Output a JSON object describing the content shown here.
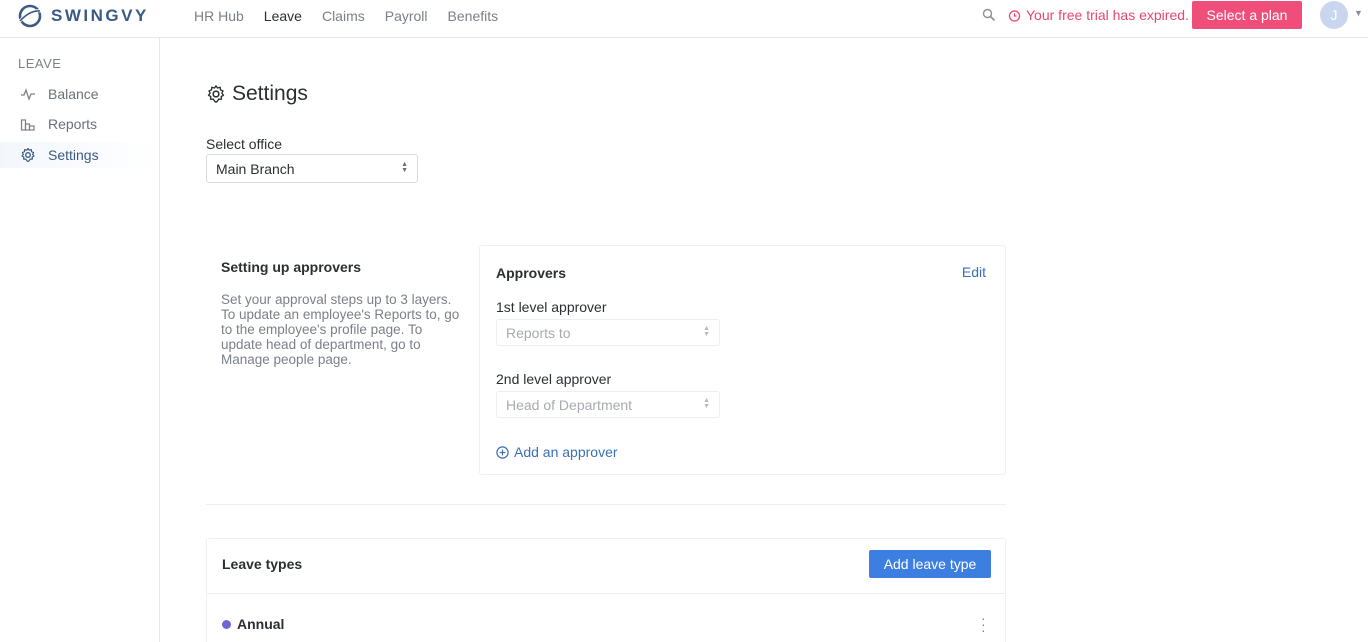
{
  "brand": {
    "name": "SWINGVY"
  },
  "nav": {
    "items": [
      "HR Hub",
      "Leave",
      "Claims",
      "Payroll",
      "Benefits"
    ],
    "active_index": 1
  },
  "trial": {
    "text": "Your free trial has expired.",
    "button": "Select a plan"
  },
  "user": {
    "initial": "J"
  },
  "sidebar": {
    "heading": "LEAVE",
    "items": [
      {
        "label": "Balance",
        "icon": "activity-icon"
      },
      {
        "label": "Reports",
        "icon": "chart-icon"
      },
      {
        "label": "Settings",
        "icon": "gear-icon",
        "active": true
      }
    ]
  },
  "page": {
    "title": "Settings",
    "office_label": "Select office",
    "office_value": "Main Branch"
  },
  "approvers": {
    "section_title": "Setting up approvers",
    "section_description": "Set your approval steps up to 3 layers. To update an employee's Reports to, go to the employee's profile page. To update head of department, go to Manage people page.",
    "panel_title": "Approvers",
    "edit_label": "Edit",
    "level1_label": "1st level approver",
    "level1_value": "Reports to",
    "level2_label": "2nd level approver",
    "level2_value": "Head of Department",
    "add_label": "Add an approver"
  },
  "leave_types": {
    "title": "Leave types",
    "add_button": "Add leave type",
    "items": [
      {
        "name": "Annual",
        "color": "#6f66d6"
      }
    ]
  },
  "colors": {
    "brand": "#3a5a86",
    "trial_alert": "#e8466f",
    "plan_button": "#ef4e7a",
    "primary_button": "#3d7fe0",
    "link": "#3a70b8"
  }
}
